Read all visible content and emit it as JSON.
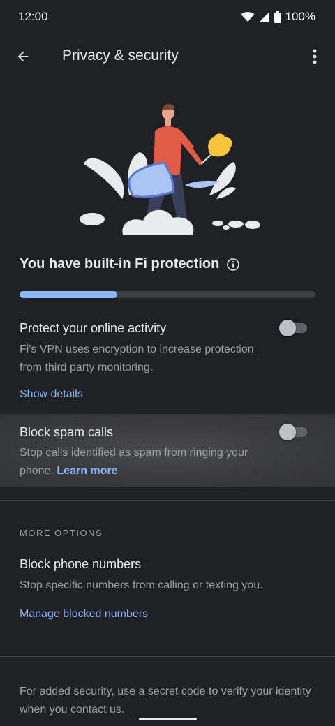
{
  "status_bar": {
    "time": "12:00",
    "battery": "100%"
  },
  "app_bar": {
    "title": "Privacy & security"
  },
  "hero": {
    "title": "You have built-in Fi protection",
    "progress": 0.33
  },
  "vpn": {
    "title": "Protect your online activity",
    "description": "Fi's VPN uses encryption to increase protection from third party monitoring.",
    "link": "Show details",
    "enabled": false
  },
  "spam": {
    "title": "Block spam calls",
    "description": "Stop calls identified as spam from ringing your phone.",
    "link": "Learn more",
    "enabled": false
  },
  "more_options": {
    "header": "MORE OPTIONS",
    "block_numbers": {
      "title": "Block phone numbers",
      "description": "Stop specific numbers from calling or texting you.",
      "link": "Manage blocked numbers"
    }
  },
  "footer": {
    "text": "For added security, use a secret code to verify your identity when you contact us."
  },
  "colors": {
    "background": "#202124",
    "accent": "#8ab4f8",
    "text": "#e8eaed",
    "secondary_text": "#9aa0a6",
    "figure_shirt": "#e25b45",
    "flower": "#f9c33b"
  },
  "icons": [
    "wifi-icon",
    "signal-icon",
    "battery-icon",
    "back-arrow-icon",
    "more-vert-icon",
    "info-icon"
  ]
}
